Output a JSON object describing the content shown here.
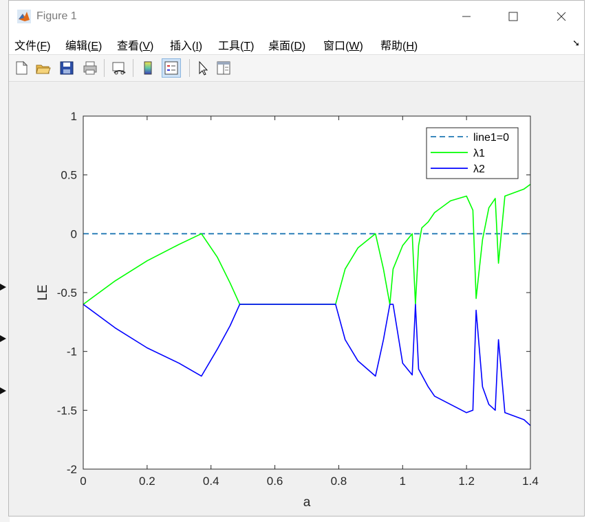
{
  "window": {
    "title": "Figure 1"
  },
  "menu": [
    {
      "label": "文件(",
      "key": "F",
      "end": ")"
    },
    {
      "label": "编辑(",
      "key": "E",
      "end": ")"
    },
    {
      "label": "查看(",
      "key": "V",
      "end": ")"
    },
    {
      "label": "插入(",
      "key": "I",
      "end": ")"
    },
    {
      "label": "工具(",
      "key": "T",
      "end": ")"
    },
    {
      "label": "桌面(",
      "key": "D",
      "end": ")"
    },
    {
      "label": "窗口(",
      "key": "W",
      "end": ")"
    },
    {
      "label": "帮助(",
      "key": "H",
      "end": ")"
    }
  ],
  "toolbar": [
    "new-figure-icon",
    "open-file-icon",
    "save-icon",
    "print-icon",
    "link-plot-icon",
    "colorbar-icon",
    "legend-icon",
    "pointer-icon",
    "property-inspector-icon"
  ],
  "colors": {
    "line1": "#1f77b4",
    "lambda1": "#00ff00",
    "lambda2": "#0000ff"
  },
  "chart_data": {
    "type": "line",
    "xlabel": "a",
    "ylabel": "LE",
    "xlim": [
      0,
      1.4
    ],
    "ylim": [
      -2,
      1
    ],
    "xticks": [
      "0",
      "0.2",
      "0.4",
      "0.6",
      "0.8",
      "1",
      "1.2",
      "1.4"
    ],
    "yticks": [
      "1",
      "0.5",
      "0",
      "-0.5",
      "-1",
      "-1.5",
      "-2"
    ],
    "legend_position": "top-right",
    "series": [
      {
        "name": "line1=0",
        "style": "dashed",
        "x": [
          0,
          1.4
        ],
        "y": [
          0,
          0
        ]
      },
      {
        "name": "λ1",
        "style": "solid",
        "x": [
          0,
          0.1,
          0.2,
          0.3,
          0.37,
          0.42,
          0.46,
          0.49,
          0.6,
          0.7,
          0.79,
          0.82,
          0.86,
          0.915,
          0.94,
          0.96,
          0.97,
          1.0,
          1.03,
          1.04,
          1.05,
          1.06,
          1.08,
          1.1,
          1.15,
          1.2,
          1.22,
          1.23,
          1.25,
          1.27,
          1.29,
          1.3,
          1.32,
          1.35,
          1.38,
          1.4
        ],
        "y": [
          -0.6,
          -0.4,
          -0.23,
          -0.09,
          0,
          -0.2,
          -0.42,
          -0.6,
          -0.6,
          -0.6,
          -0.6,
          -0.3,
          -0.12,
          0,
          -0.3,
          -0.6,
          -0.3,
          -0.1,
          0,
          -0.6,
          -0.1,
          0.05,
          0.1,
          0.18,
          0.28,
          0.32,
          0.2,
          -0.55,
          -0.05,
          0.22,
          0.3,
          -0.25,
          0.32,
          0.35,
          0.38,
          0.42
        ]
      },
      {
        "name": "λ2",
        "style": "solid",
        "x": [
          0,
          0.1,
          0.2,
          0.3,
          0.37,
          0.42,
          0.46,
          0.49,
          0.6,
          0.7,
          0.79,
          0.82,
          0.86,
          0.915,
          0.94,
          0.96,
          0.97,
          1.0,
          1.03,
          1.04,
          1.05,
          1.06,
          1.08,
          1.1,
          1.15,
          1.2,
          1.22,
          1.23,
          1.25,
          1.27,
          1.29,
          1.3,
          1.32,
          1.35,
          1.38,
          1.4
        ],
        "y": [
          -0.6,
          -0.8,
          -0.97,
          -1.1,
          -1.21,
          -0.98,
          -0.78,
          -0.6,
          -0.6,
          -0.6,
          -0.6,
          -0.9,
          -1.08,
          -1.21,
          -0.9,
          -0.6,
          -0.6,
          -1.1,
          -1.2,
          -0.6,
          -1.15,
          -1.2,
          -1.3,
          -1.38,
          -1.45,
          -1.52,
          -1.5,
          -0.65,
          -1.3,
          -1.45,
          -1.5,
          -0.9,
          -1.52,
          -1.55,
          -1.58,
          -1.63
        ]
      }
    ]
  }
}
